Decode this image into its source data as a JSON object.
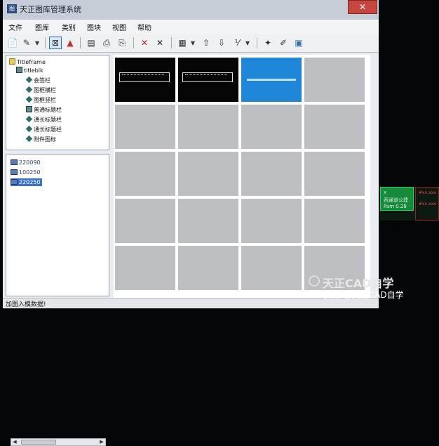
{
  "window": {
    "title": "天正图库管理系统",
    "app_icon_text": "图",
    "close_glyph": "✕"
  },
  "menu": [
    "文件",
    "图库",
    "类别",
    "图块",
    "视图",
    "帮助"
  ],
  "toolbar_glyphs": [
    "📄",
    "✎",
    "▾",
    "⊠",
    "▲",
    "▤",
    "⎙",
    "⎘",
    "✕",
    "✕",
    "▦",
    "▾",
    "⇧",
    "⇩",
    "⅟",
    "▾",
    "✦",
    "✐",
    "▣"
  ],
  "tree": {
    "root": "Titleframe",
    "child": "titleblk",
    "items": [
      "会签栏",
      "图框横栏",
      "图框竖栏",
      "普通标题栏",
      "通长标题栏",
      "通长标题栏",
      "附件图标"
    ]
  },
  "list": {
    "items": [
      "220090",
      "100250",
      "220250"
    ],
    "selected_index": 2
  },
  "status": "加图入模数据!",
  "preview": {
    "rows": 5,
    "cols": 4,
    "filled": [
      "black",
      "black",
      "blue"
    ]
  },
  "side_panel": {
    "green_lines": [
      "x",
      "西通道公建",
      "Pam 0.28"
    ],
    "red_lines": [
      "#xx.xxx",
      "#xx.xxx"
    ]
  },
  "watermark": {
    "large": "天正CAD自学",
    "small": "头条 @天正CAD自学"
  }
}
